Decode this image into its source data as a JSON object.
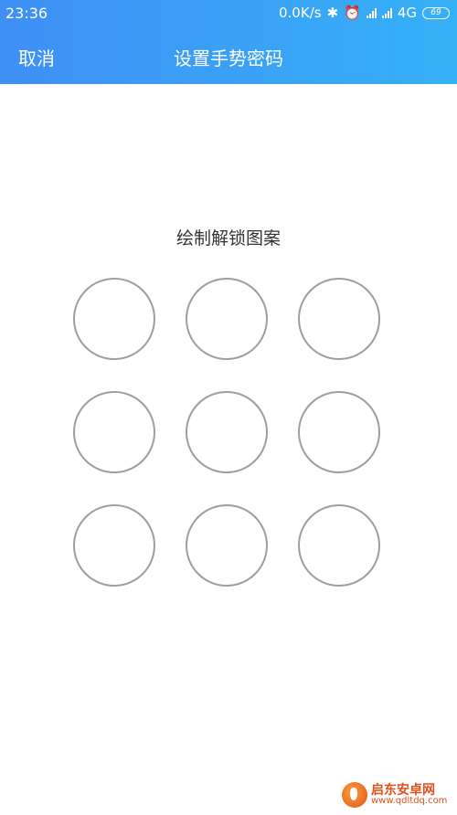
{
  "status_bar": {
    "time": "23:36",
    "net_speed": "0.0K/s",
    "network": "4G",
    "battery": "69"
  },
  "nav": {
    "cancel_label": "取消",
    "title": "设置手势密码"
  },
  "prompt": "绘制解锁图案",
  "pattern_grid": {
    "rows": 3,
    "cols": 3
  },
  "watermark": {
    "brand": "启东安卓网",
    "domain": "www.qdltdq.com"
  },
  "colors": {
    "header_gradient_start": "#3f8ff5",
    "header_gradient_end": "#35b1f7",
    "circle_border": "#9e9e9e"
  }
}
